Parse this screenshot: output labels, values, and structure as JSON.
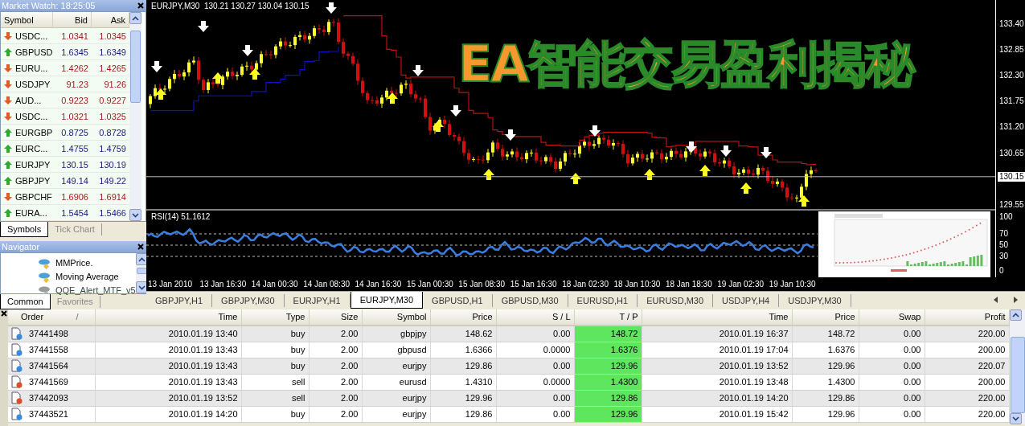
{
  "market_watch": {
    "title": "Market Watch: 18:25:05",
    "columns": [
      "Symbol",
      "Bid",
      "Ask"
    ],
    "rows": [
      {
        "symbol": "USDC...",
        "bid": "1.0341",
        "ask": "1.0345",
        "kind": "down"
      },
      {
        "symbol": "GBPUSD",
        "bid": "1.6345",
        "ask": "1.6349",
        "kind": "up"
      },
      {
        "symbol": "EURU...",
        "bid": "1.4262",
        "ask": "1.4265",
        "kind": "down"
      },
      {
        "symbol": "USDJPY",
        "bid": "91.23",
        "ask": "91.26",
        "kind": "down"
      },
      {
        "symbol": "AUD...",
        "bid": "0.9223",
        "ask": "0.9227",
        "kind": "down"
      },
      {
        "symbol": "USDC...",
        "bid": "1.0321",
        "ask": "1.0325",
        "kind": "down"
      },
      {
        "symbol": "EURGBP",
        "bid": "0.8725",
        "ask": "0.8728",
        "kind": "up"
      },
      {
        "symbol": "EURC...",
        "bid": "1.4755",
        "ask": "1.4759",
        "kind": "up"
      },
      {
        "symbol": "EURJPY",
        "bid": "130.15",
        "ask": "130.19",
        "kind": "up"
      },
      {
        "symbol": "GBPJPY",
        "bid": "149.14",
        "ask": "149.22",
        "kind": "up"
      },
      {
        "symbol": "GBPCHF",
        "bid": "1.6906",
        "ask": "1.6914",
        "kind": "down"
      },
      {
        "symbol": "EURA...",
        "bid": "1.5454",
        "ask": "1.5466",
        "kind": "up"
      }
    ],
    "tabs": [
      {
        "label": "Symbols",
        "selected": true
      },
      {
        "label": "Tick Chart",
        "selected": false
      }
    ]
  },
  "navigator": {
    "title": "Navigator",
    "items": [
      {
        "label": "MMPrice.",
        "enabled": true
      },
      {
        "label": "Moving Average",
        "enabled": true
      },
      {
        "label": "QQE_Alert_MTF_v5",
        "enabled": false
      }
    ],
    "tabs": [
      {
        "label": "Common",
        "selected": true
      },
      {
        "label": "Favorites",
        "selected": false
      }
    ]
  },
  "chart": {
    "header": "EURJPY,M30  130.21 130.27 130.04 130.15",
    "overlay_title": "EA智能交易盈利揭秘",
    "price_labels": [
      "133.40",
      "132.85",
      "132.30",
      "131.75",
      "131.20",
      "130.65",
      "129.55"
    ],
    "current_price": "130.15",
    "indicator": {
      "header": "RSI(14) 51.1612",
      "levels": [
        "100",
        "70",
        "50",
        "30",
        "0"
      ]
    },
    "time_labels": [
      "13 Jan 2010",
      "13 Jan 16:30",
      "14 Jan 00:30",
      "14 Jan 08:30",
      "14 Jan 16:30",
      "15 Jan 00:30",
      "15 Jan 08:30",
      "15 Jan 16:30",
      "18 Jan 02:30",
      "18 Jan 10:30",
      "18 Jan 18:30",
      "19 Jan 02:30",
      "19 Jan 10:30"
    ]
  },
  "chart_tabs": [
    {
      "label": "GBPJPY,H1",
      "selected": false
    },
    {
      "label": "GBPJPY,M30",
      "selected": false
    },
    {
      "label": "EURJPY,H1",
      "selected": false
    },
    {
      "label": "EURJPY,M30",
      "selected": true
    },
    {
      "label": "GBPUSD,H1",
      "selected": false
    },
    {
      "label": "GBPUSD,M30",
      "selected": false
    },
    {
      "label": "EURUSD,H1",
      "selected": false
    },
    {
      "label": "EURUSD,M30",
      "selected": false
    },
    {
      "label": "USDJPY,H4",
      "selected": false
    },
    {
      "label": "USDJPY,M30",
      "selected": false
    }
  ],
  "orders": {
    "columns": [
      "Order",
      "Time",
      "Type",
      "Size",
      "Symbol",
      "Price",
      "S / L",
      "T / P",
      "Time",
      "Price",
      "Swap",
      "Profit"
    ],
    "sort_mark": "/",
    "rows": [
      {
        "kind": "buy",
        "cells": [
          "37441498",
          "2010.01.19 13:40",
          "buy",
          "2.00",
          "gbpjpy",
          "148.62",
          "0.00",
          "148.72",
          "2010.01.19 16:37",
          "148.72",
          "0.00",
          "220.00"
        ]
      },
      {
        "kind": "buy",
        "cells": [
          "37441558",
          "2010.01.19 13:43",
          "buy",
          "2.00",
          "gbpusd",
          "1.6366",
          "0.0000",
          "1.6376",
          "2010.01.19 17:04",
          "1.6376",
          "0.00",
          "200.00"
        ]
      },
      {
        "kind": "buy",
        "cells": [
          "37441564",
          "2010.01.19 13:43",
          "buy",
          "2.00",
          "eurjpy",
          "129.86",
          "0.00",
          "129.96",
          "2010.01.19 13:52",
          "129.96",
          "0.00",
          "220.07"
        ]
      },
      {
        "kind": "sell",
        "cells": [
          "37441569",
          "2010.01.19 13:43",
          "sell",
          "2.00",
          "eurusd",
          "1.4310",
          "0.0000",
          "1.4300",
          "2010.01.19 13:48",
          "1.4300",
          "0.00",
          "200.00"
        ]
      },
      {
        "kind": "sell",
        "cells": [
          "37442093",
          "2010.01.19 13:52",
          "sell",
          "2.00",
          "eurjpy",
          "129.96",
          "0.00",
          "129.86",
          "2010.01.19 14:20",
          "129.86",
          "0.00",
          "220.00"
        ]
      },
      {
        "kind": "buy",
        "cells": [
          "37443521",
          "2010.01.19 14:20",
          "buy",
          "2.00",
          "eurjpy",
          "129.86",
          "0.00",
          "129.96",
          "2010.01.19 15:42",
          "129.96",
          "0.00",
          "220.00"
        ]
      }
    ]
  }
}
